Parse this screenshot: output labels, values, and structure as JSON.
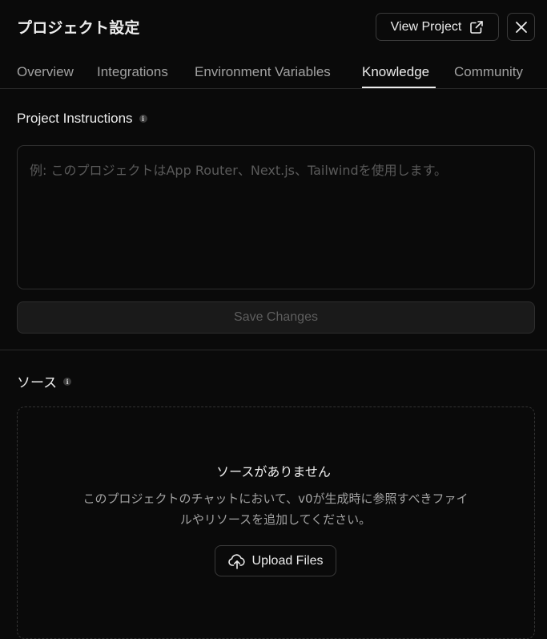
{
  "header": {
    "title": "プロジェクト設定",
    "view_project_label": "View Project",
    "view_project_icon": "external-link-icon",
    "close_icon": "close-icon"
  },
  "tabs": [
    {
      "label": "Overview",
      "active": false
    },
    {
      "label": "Integrations",
      "active": false
    },
    {
      "label": "Environment Variables",
      "active": false
    },
    {
      "label": "Knowledge",
      "active": true
    },
    {
      "label": "Community",
      "active": false
    }
  ],
  "instructions": {
    "label": "Project Instructions",
    "info_icon": "info-icon",
    "value": "",
    "placeholder": "例: このプロジェクトはApp Router、Next.js、Tailwindを使用します。",
    "save_label": "Save Changes"
  },
  "sources": {
    "label": "ソース",
    "info_icon": "info-icon",
    "empty_title": "ソースがありません",
    "empty_desc_line1": "このプロジェクトのチャットにおいて、v0が生成時に参照すべきファイ",
    "empty_desc_line2": "ルやリソースを追加してください。",
    "upload_label": "Upload Files",
    "upload_icon": "cloud-upload-icon"
  },
  "colors": {
    "background": "#0a0a0a",
    "text": "#ededed",
    "muted": "#a1a1a1",
    "border": "#2e2e2e"
  }
}
